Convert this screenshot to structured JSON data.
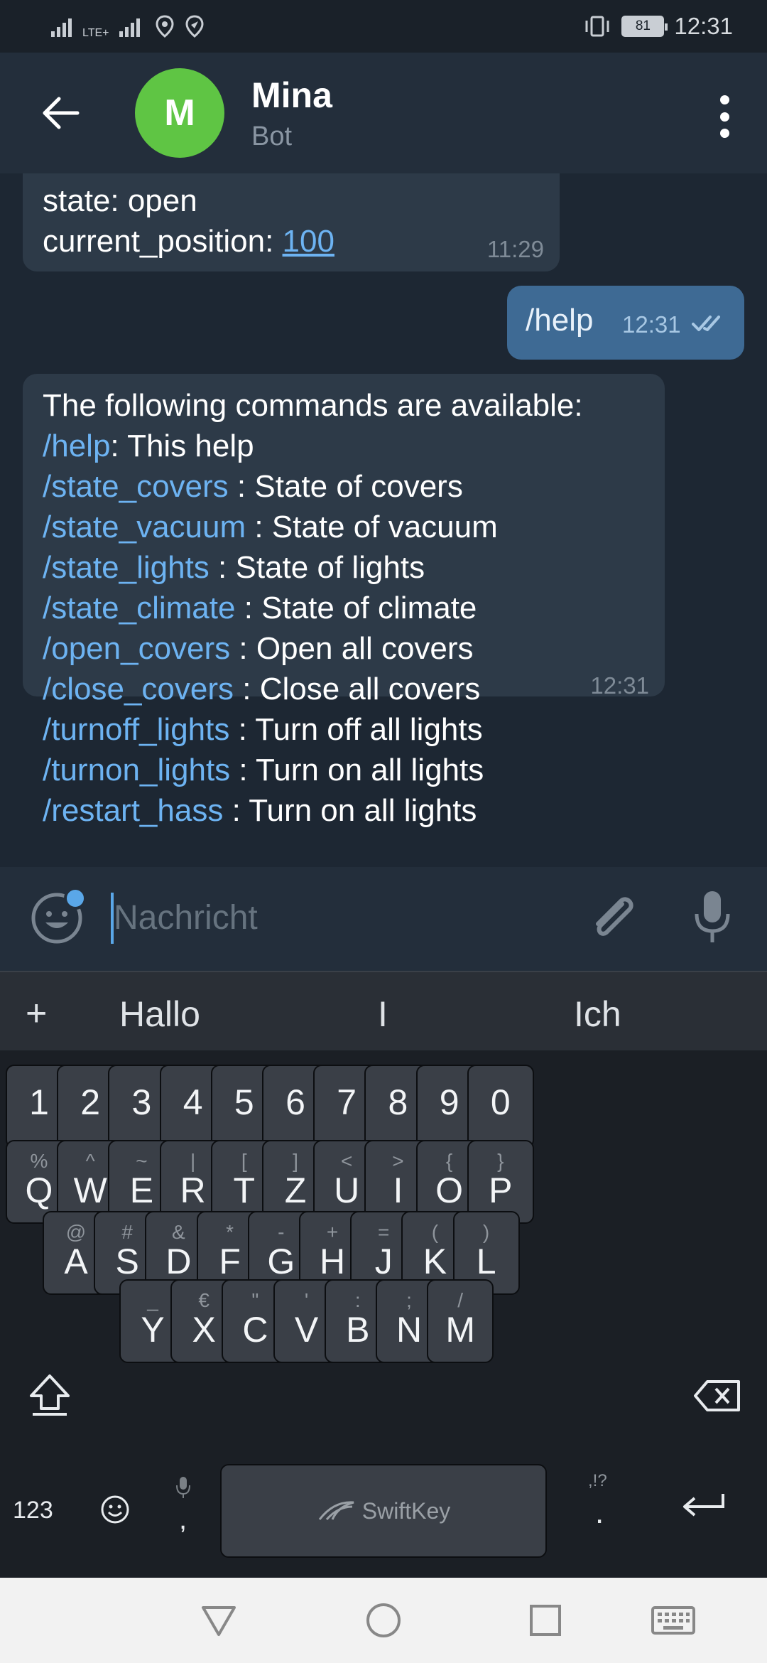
{
  "status_bar": {
    "lte_label": "LTE+",
    "battery": "81",
    "time": "12:31"
  },
  "header": {
    "avatar_letter": "M",
    "name": "Mina",
    "subtitle": "Bot"
  },
  "messages": {
    "first": {
      "line1": "state: open",
      "line2_label": "current_position: ",
      "line2_value": "100",
      "time": "11:29"
    },
    "outgoing": {
      "text": "/help",
      "time": "12:31"
    },
    "help": {
      "intro": "The following commands are available:",
      "commands": [
        {
          "cmd": "/help",
          "desc": ": This help"
        },
        {
          "cmd": "/state_covers",
          "desc": " : State of covers"
        },
        {
          "cmd": "/state_vacuum",
          "desc": " : State of vacuum"
        },
        {
          "cmd": "/state_lights",
          "desc": " : State of lights"
        },
        {
          "cmd": "/state_climate",
          "desc": " : State of climate"
        },
        {
          "cmd": "/open_covers",
          "desc": " : Open all covers"
        },
        {
          "cmd": "/close_covers",
          "desc": " : Close all covers"
        },
        {
          "cmd": "/turnoff_lights",
          "desc": " : Turn off all lights"
        },
        {
          "cmd": "/turnon_lights",
          "desc": " : Turn on all lights"
        },
        {
          "cmd": "/restart_hass",
          "desc": " : Turn on all lights"
        }
      ],
      "time": "12:31"
    }
  },
  "input": {
    "placeholder": "Nachricht"
  },
  "suggestions": {
    "plus": "+",
    "items": [
      "Hallo",
      "I",
      "Ich"
    ]
  },
  "keyboard": {
    "numbers": [
      "1",
      "2",
      "3",
      "4",
      "5",
      "6",
      "7",
      "8",
      "9",
      "0"
    ],
    "row1": [
      {
        "main": "Q",
        "sec": "%"
      },
      {
        "main": "W",
        "sec": "^"
      },
      {
        "main": "E",
        "sec": "~"
      },
      {
        "main": "R",
        "sec": "|"
      },
      {
        "main": "T",
        "sec": "["
      },
      {
        "main": "Z",
        "sec": "]"
      },
      {
        "main": "U",
        "sec": "<"
      },
      {
        "main": "I",
        "sec": ">"
      },
      {
        "main": "O",
        "sec": "{"
      },
      {
        "main": "P",
        "sec": "}"
      }
    ],
    "row2": [
      {
        "main": "A",
        "sec": "@"
      },
      {
        "main": "S",
        "sec": "#"
      },
      {
        "main": "D",
        "sec": "&"
      },
      {
        "main": "F",
        "sec": "*"
      },
      {
        "main": "G",
        "sec": "-"
      },
      {
        "main": "H",
        "sec": "+"
      },
      {
        "main": "J",
        "sec": "="
      },
      {
        "main": "K",
        "sec": "("
      },
      {
        "main": "L",
        "sec": ")"
      }
    ],
    "row3": [
      {
        "main": "Y",
        "sec": "_"
      },
      {
        "main": "X",
        "sec": "€"
      },
      {
        "main": "C",
        "sec": "\""
      },
      {
        "main": "V",
        "sec": "'"
      },
      {
        "main": "B",
        "sec": ":"
      },
      {
        "main": "N",
        "sec": ";"
      },
      {
        "main": "M",
        "sec": "/"
      }
    ],
    "num_switch": "123",
    "comma": ",",
    "period": ".",
    "period_sec": ",!?",
    "space_brand": "SwiftKey"
  },
  "icons": {
    "back": "arrow-left-icon",
    "more": "more-vertical-icon",
    "emoji": "emoji-icon",
    "attach": "paperclip-icon",
    "mic": "microphone-icon",
    "read": "double-check-icon"
  },
  "colors": {
    "accent": "#6db3f2",
    "outgoing_bubble": "#3e6a94",
    "incoming_bubble": "#2d3a48",
    "avatar": "#5fc544"
  }
}
